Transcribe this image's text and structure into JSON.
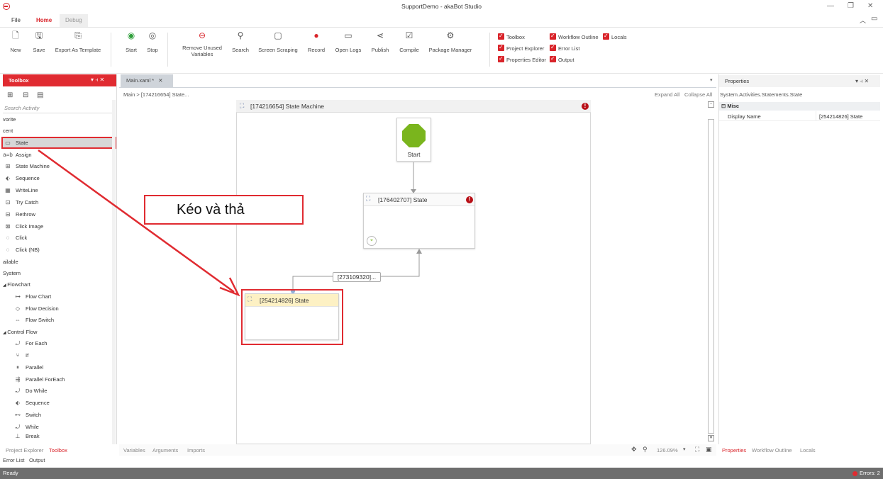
{
  "window": {
    "title": "SupportDemo - akaBot Studio"
  },
  "menu_tabs": [
    "File",
    "Home",
    "Debug"
  ],
  "ribbon": {
    "new": "New",
    "save": "Save",
    "export": "Export As Template",
    "start": "Start",
    "stop": "Stop",
    "remove_unused_1": "Remove Unused",
    "remove_unused_2": "Variables",
    "search": "Search",
    "screen_scraping": "Screen Scraping",
    "record": "Record",
    "open_logs": "Open Logs",
    "publish": "Publish",
    "compile": "Compile",
    "package_manager": "Package Manager",
    "checks": {
      "toolbox": "Toolbox",
      "workflow_outline": "Workflow Outline",
      "locals": "Locals",
      "project_explorer": "Project Explorer",
      "error_list": "Error List",
      "properties_editor": "Properties Editor",
      "output": "Output"
    }
  },
  "toolbox": {
    "title": "Toolbox",
    "search_placeholder": "Search Activity",
    "sections": {
      "favorite": "vorite",
      "recent": "cent",
      "available": "ailable",
      "system": "System",
      "flowchart": "Flowchart",
      "control_flow": "Control Flow"
    },
    "recent_items": [
      "State",
      "Assign",
      "State Machine",
      "Sequence",
      "WriteLine",
      "Try Catch",
      "Rethrow",
      "Click Image",
      "Click",
      "Click (NB)"
    ],
    "flowchart_items": [
      "Flow Chart",
      "Flow Decision",
      "Flow Switch"
    ],
    "control_items": [
      "For Each",
      "If",
      "Parallel",
      "Parallel ForEach",
      "Do While",
      "Sequence",
      "Switch",
      "While",
      "Break"
    ]
  },
  "doc_tab": "Main.xaml *",
  "breadcrumb": {
    "root": "Main",
    "sep": ">",
    "current": "[174216654] State..."
  },
  "canvas_tools": {
    "expand_all": "Expand All",
    "collapse_all": "Collapse All"
  },
  "designer": {
    "state_machine": "[174216654] State Machine",
    "start": "Start",
    "state1": "[176402707] State",
    "transition": "[273109320]...",
    "state2": "[254214826] State",
    "annotation": "Kéo và thả"
  },
  "properties": {
    "title": "Properties",
    "type": "System.Activities.Statements.State",
    "category": "Misc",
    "display_name_label": "Display Name",
    "display_name_value": "[254214826] State"
  },
  "bottom_left_tabs": [
    "Project Explorer",
    "Toolbox"
  ],
  "bottom_row": [
    "Error List",
    "Output"
  ],
  "designer_tabs": [
    "Variables",
    "Arguments",
    "Imports"
  ],
  "zoom": "126.09%",
  "right_tabs": [
    "Properties",
    "Workflow Outline",
    "Locals"
  ],
  "status": {
    "left": "Ready",
    "errors": "Errors: 2"
  },
  "colors": {
    "accent": "#d9242a",
    "state_highlight": "#fdf1c4",
    "start_node": "#7ab51d"
  }
}
